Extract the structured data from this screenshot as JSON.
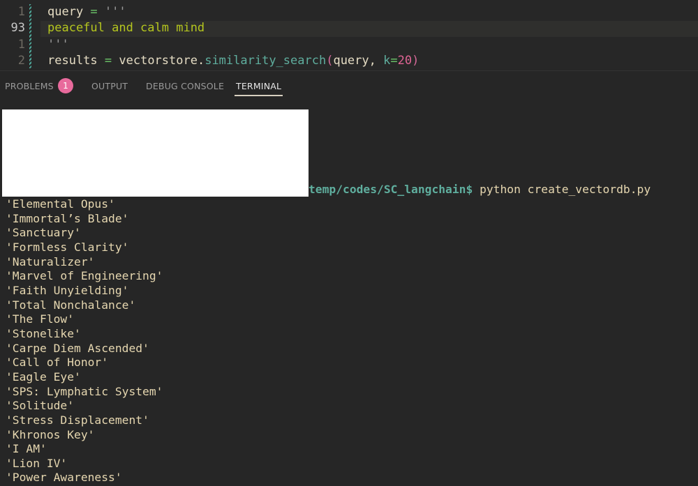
{
  "editor": {
    "lines": [
      {
        "number": "1",
        "code": "query = '''"
      },
      {
        "number": "93",
        "code": "peaceful and calm mind"
      },
      {
        "number": "1",
        "code": "'''"
      },
      {
        "number": "2",
        "code": "results = vectorstore.similarity_search(query, k=20)"
      }
    ]
  },
  "panel": {
    "tabs": [
      {
        "label": "PROBLEMS",
        "badge": "1"
      },
      {
        "label": "OUTPUT"
      },
      {
        "label": "DEBUG CONSOLE"
      },
      {
        "label": "TERMINAL",
        "active": true
      }
    ]
  },
  "terminal": {
    "prompt_path": "temp/codes/SC_langchain$",
    "command": " python create_vectordb.py",
    "output": [
      "'Elemental Opus'",
      "'Immortal’s Blade'",
      "'Sanctuary'",
      "'Formless Clarity'",
      "'Naturalizer'",
      "'Marvel of Engineering'",
      "'Faith Unyielding'",
      "'Total Nonchalance'",
      "'The Flow'",
      "'Stonelike'",
      "'Carpe Diem Ascended'",
      "'Call of Honor'",
      "'Eagle Eye'",
      "'SPS: Lymphatic System'",
      "'Solitude'",
      "'Stress Displacement'",
      "'Khronos Key'",
      "'I AM'",
      "'Lion IV'",
      "'Power Awareness'"
    ]
  },
  "colors": {
    "badge": "#e86a9c",
    "string": "#b5c61e",
    "function": "#5fae9e",
    "number": "#e06494",
    "terminal_text": "#e6d7b0"
  }
}
